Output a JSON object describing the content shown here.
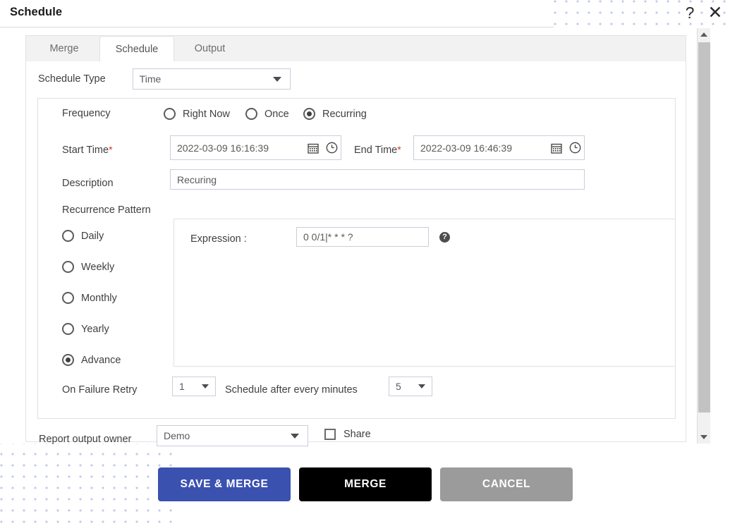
{
  "window": {
    "title": "Schedule",
    "help_icon": "question-mark-icon",
    "close_icon": "close-x-icon"
  },
  "tabs": [
    {
      "id": "merge",
      "label": "Merge",
      "active": false
    },
    {
      "id": "schedule",
      "label": "Schedule",
      "active": true
    },
    {
      "id": "output",
      "label": "Output",
      "active": false
    }
  ],
  "form": {
    "schedule_type": {
      "label": "Schedule Type",
      "value": "Time"
    },
    "frequency": {
      "label": "Frequency",
      "options": [
        {
          "label": "Right Now",
          "selected": false
        },
        {
          "label": "Once",
          "selected": false
        },
        {
          "label": "Recurring",
          "selected": true
        }
      ]
    },
    "start_time": {
      "label": "Start Time",
      "required": "*",
      "value": "2022-03-09 16:16:39",
      "calendar_icon": "calendar-icon",
      "clock_icon": "clock-icon"
    },
    "end_time": {
      "label": "End Time",
      "required": "*",
      "value": "2022-03-09 16:46:39",
      "calendar_icon": "calendar-icon",
      "clock_icon": "clock-icon"
    },
    "description": {
      "label": "Description",
      "value": "Recuring"
    },
    "recurrence_pattern": {
      "label": "Recurrence Pattern",
      "options": [
        {
          "label": "Daily",
          "selected": false
        },
        {
          "label": "Weekly",
          "selected": false
        },
        {
          "label": "Monthly",
          "selected": false
        },
        {
          "label": "Yearly",
          "selected": false
        },
        {
          "label": "Advance",
          "selected": true
        }
      ]
    },
    "expression": {
      "label": "Expression :",
      "value": "0 0/1|* * * ?",
      "help_icon": "question-circle-icon",
      "help_glyph": "?"
    },
    "on_failure_retry": {
      "label": "On Failure Retry",
      "value": "1"
    },
    "schedule_after_every_minutes": {
      "label": "Schedule after every minutes",
      "value": "5"
    },
    "report_output_owner": {
      "label": "Report output owner",
      "value": "Demo"
    },
    "share": {
      "label": "Share",
      "checked": false
    }
  },
  "scrollbar": {
    "up_arrow_icon": "triangle-up-icon",
    "down_arrow_icon": "triangle-down-icon"
  },
  "footer": {
    "save_merge_label": "SAVE & MERGE",
    "merge_label": "MERGE",
    "cancel_label": "CANCEL"
  },
  "colors": {
    "primary": "#3b51b0",
    "merge": "#000000",
    "cancel": "#9b9b9b",
    "required": "#e03030",
    "dots": "#c3c9ee"
  }
}
